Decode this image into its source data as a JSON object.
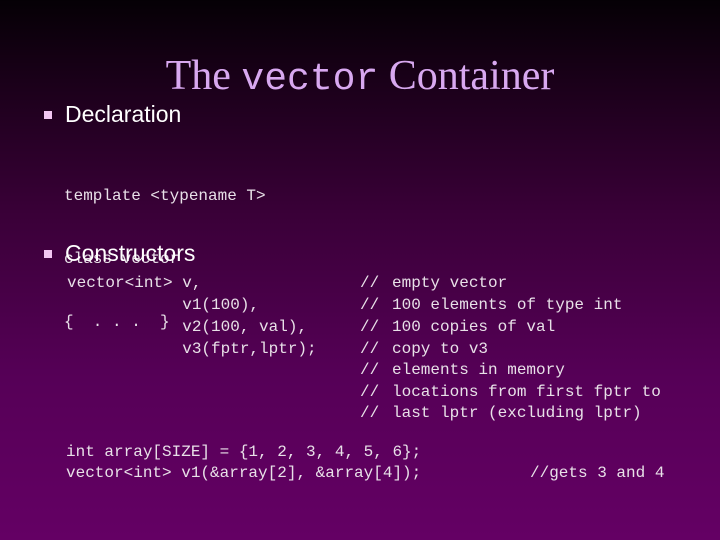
{
  "title": {
    "before": "The ",
    "code": "vector",
    "after": " Container"
  },
  "colors": {
    "title": "#d8a8f0",
    "bullet": "#f2c6f2",
    "bg_top": "#050005",
    "bg_bottom": "#640064"
  },
  "sections": [
    {
      "heading": "Declaration",
      "code_lines": [
        "template <typename T>",
        "class vector",
        "{  . . .  }"
      ]
    },
    {
      "heading": "Constructors",
      "constructor_rows": [
        {
          "decl": "vector<int> v,",
          "comment": "//",
          "text": "empty vector"
        },
        {
          "decl": "            v1(100),",
          "comment": "//",
          "text": "100 elements of type int"
        },
        {
          "decl": "            v2(100, val),",
          "comment": "//",
          "text": "100 copies of val"
        },
        {
          "decl": "            v3(fptr,lptr);",
          "comment": "//",
          "text": "copy to v3"
        },
        {
          "decl": "",
          "comment": "//",
          "text": "elements in memory"
        },
        {
          "decl": "",
          "comment": "//",
          "text": "locations from first fptr to"
        },
        {
          "decl": "",
          "comment": "//",
          "text": "last lptr (excluding lptr)"
        }
      ]
    }
  ],
  "example": {
    "line1": "int array[SIZE] = {1, 2, 3, 4, 5, 6};",
    "line2": "vector<int> v1(&array[2], &array[4]);",
    "line2_comment": "//gets 3 and 4"
  }
}
